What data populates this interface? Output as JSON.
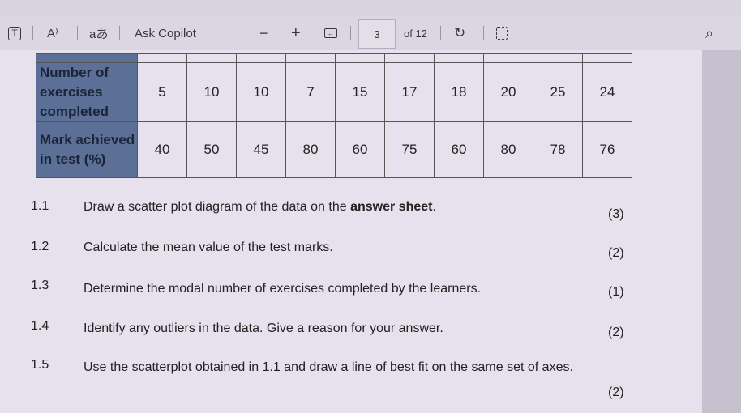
{
  "toolbar": {
    "text_icon": "text-box-icon",
    "read_aloud_label": "A⁾",
    "translate_label": "aあ",
    "ask_copilot": "Ask Copilot",
    "zoom_out": "−",
    "zoom_in": "+",
    "page_current": "3",
    "page_total": "of 12",
    "rotate_icon": "rotate-icon",
    "page_view_icon": "page-view-icon",
    "search_icon": "search-icon"
  },
  "table": {
    "rows": [
      {
        "header": "Number of exercises completed",
        "values": [
          "5",
          "10",
          "10",
          "7",
          "15",
          "17",
          "18",
          "20",
          "25",
          "24"
        ]
      },
      {
        "header": "Mark achieved in test (%)",
        "values": [
          "40",
          "50",
          "45",
          "80",
          "60",
          "75",
          "60",
          "80",
          "78",
          "76"
        ]
      }
    ]
  },
  "questions": [
    {
      "num": "1.1",
      "text_before": "Draw a scatter plot diagram of the data on the ",
      "bold": "answer sheet",
      "text_after": ".",
      "marks": "(3)"
    },
    {
      "num": "1.2",
      "text": "Calculate the mean value of the test marks.",
      "marks": "(2)"
    },
    {
      "num": "1.3",
      "text": "Determine the modal number of exercises completed by the learners.",
      "marks": "(1)"
    },
    {
      "num": "1.4",
      "text": "Identify any outliers in the data. Give a reason for your answer.",
      "marks": "(2)"
    },
    {
      "num": "1.5",
      "text": "Use the scatterplot obtained in 1.1 and draw a line of best fit on the same set of axes.",
      "marks": "(2)"
    }
  ]
}
